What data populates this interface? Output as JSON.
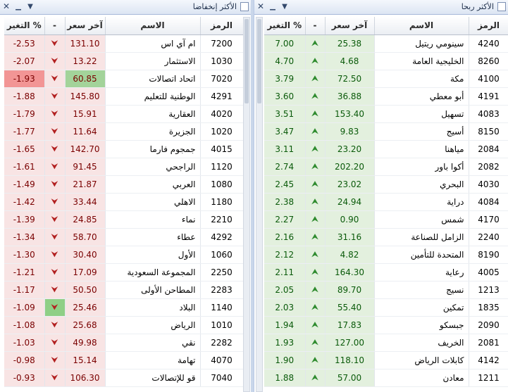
{
  "colors": {
    "gain": "#2e8b2e",
    "loss": "#b22020",
    "gain_bg": "#e3f0de",
    "loss_bg": "#f8e4e4"
  },
  "columns": {
    "symbol": "الرمز",
    "name": "الاسم",
    "last_price": "آخر سعر",
    "direction": "-",
    "change_pct": "التغير %"
  },
  "gainers": {
    "title": "الأكثر ربحا",
    "rows": [
      {
        "symbol": "4240",
        "name": "سينومي ريتيل",
        "price": "25.38",
        "change": "7.00"
      },
      {
        "symbol": "8260",
        "name": "الخليجية العامة",
        "price": "4.68",
        "change": "4.70"
      },
      {
        "symbol": "4100",
        "name": "مكة",
        "price": "72.50",
        "change": "3.79"
      },
      {
        "symbol": "4191",
        "name": "أبو معطي",
        "price": "36.88",
        "change": "3.60"
      },
      {
        "symbol": "4083",
        "name": "تسهيل",
        "price": "153.40",
        "change": "3.51"
      },
      {
        "symbol": "8150",
        "name": "أسيج",
        "price": "9.83",
        "change": "3.47"
      },
      {
        "symbol": "2084",
        "name": "مياهنا",
        "price": "23.20",
        "change": "3.11"
      },
      {
        "symbol": "2082",
        "name": "أكوا باور",
        "price": "202.20",
        "change": "2.74"
      },
      {
        "symbol": "4030",
        "name": "البحري",
        "price": "23.02",
        "change": "2.45"
      },
      {
        "symbol": "4084",
        "name": "دراية",
        "price": "24.94",
        "change": "2.38"
      },
      {
        "symbol": "4170",
        "name": "شمس",
        "price": "0.90",
        "change": "2.27"
      },
      {
        "symbol": "2240",
        "name": "الزامل للصناعة",
        "price": "31.16",
        "change": "2.16"
      },
      {
        "symbol": "8190",
        "name": "المتحدة للتأمين",
        "price": "4.82",
        "change": "2.12"
      },
      {
        "symbol": "4005",
        "name": "رعاية",
        "price": "164.30",
        "change": "2.11"
      },
      {
        "symbol": "1213",
        "name": "نسيج",
        "price": "89.70",
        "change": "2.05"
      },
      {
        "symbol": "1835",
        "name": "تمكين",
        "price": "55.40",
        "change": "2.03"
      },
      {
        "symbol": "2090",
        "name": "جبسكو",
        "price": "17.83",
        "change": "1.94"
      },
      {
        "symbol": "2081",
        "name": "الخريف",
        "price": "127.00",
        "change": "1.93"
      },
      {
        "symbol": "4142",
        "name": "كابلات الرياض",
        "price": "118.10",
        "change": "1.90"
      },
      {
        "symbol": "1211",
        "name": "معادن",
        "price": "57.00",
        "change": "1.88"
      }
    ]
  },
  "losers": {
    "title": "الأكثر إنخفاضا",
    "rows": [
      {
        "symbol": "7200",
        "name": "ام آي اس",
        "price": "131.10",
        "change": "-2.53"
      },
      {
        "symbol": "1030",
        "name": "الاستثمار",
        "price": "13.22",
        "change": "-2.07"
      },
      {
        "symbol": "7020",
        "name": "اتحاد اتصالات",
        "price": "60.85",
        "change": "-1.93"
      },
      {
        "symbol": "4291",
        "name": "الوطنية للتعليم",
        "price": "145.80",
        "change": "-1.88"
      },
      {
        "symbol": "4020",
        "name": "العقارية",
        "price": "15.91",
        "change": "-1.79"
      },
      {
        "symbol": "1020",
        "name": "الجزيرة",
        "price": "11.64",
        "change": "-1.77"
      },
      {
        "symbol": "4015",
        "name": "جمجوم فارما",
        "price": "142.70",
        "change": "-1.65"
      },
      {
        "symbol": "1120",
        "name": "الراجحي",
        "price": "91.45",
        "change": "-1.61"
      },
      {
        "symbol": "1080",
        "name": "العربي",
        "price": "21.87",
        "change": "-1.49"
      },
      {
        "symbol": "1180",
        "name": "الاهلي",
        "price": "33.44",
        "change": "-1.42"
      },
      {
        "symbol": "2210",
        "name": "نماء",
        "price": "24.85",
        "change": "-1.39"
      },
      {
        "symbol": "4292",
        "name": "عطاء",
        "price": "58.70",
        "change": "-1.34"
      },
      {
        "symbol": "1060",
        "name": "الأول",
        "price": "30.40",
        "change": "-1.30"
      },
      {
        "symbol": "2250",
        "name": "المجموعة السعودية",
        "price": "17.09",
        "change": "-1.21"
      },
      {
        "symbol": "2283",
        "name": "المطاحن الأولى",
        "price": "50.50",
        "change": "-1.17"
      },
      {
        "symbol": "1140",
        "name": "البلاد",
        "price": "25.46",
        "change": "-1.09"
      },
      {
        "symbol": "1010",
        "name": "الرياض",
        "price": "25.68",
        "change": "-1.08"
      },
      {
        "symbol": "2282",
        "name": "نقي",
        "price": "49.98",
        "change": "-1.03"
      },
      {
        "symbol": "4070",
        "name": "تهامة",
        "price": "15.14",
        "change": "-0.98"
      },
      {
        "symbol": "7040",
        "name": "قو للإتصالات",
        "price": "106.30",
        "change": "-0.93"
      }
    ]
  }
}
